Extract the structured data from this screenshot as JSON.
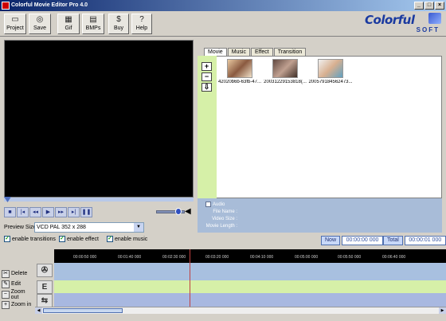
{
  "window": {
    "title": "Colorful Movie Editor Pro 4.0"
  },
  "toolbar": {
    "buttons": [
      {
        "label": "Project",
        "icon": "project-icon"
      },
      {
        "label": "Save",
        "icon": "save-icon"
      },
      {
        "label": "Gif",
        "icon": "gif-icon"
      },
      {
        "label": "BMPs",
        "icon": "bmps-icon"
      },
      {
        "label": "Buy",
        "icon": "dollar-icon"
      },
      {
        "label": "Help",
        "icon": "help-icon"
      }
    ]
  },
  "logo": {
    "line1": "Colorful",
    "line2": "SOFT"
  },
  "preview": {
    "size_label": "Preview Size",
    "size_value": "VCD PAL 352 x 288",
    "volume_level": 0.65
  },
  "options": {
    "enable_transitions": "enable transitions",
    "enable_effect": "enable effect",
    "enable_music": "enable music"
  },
  "media": {
    "tabs": [
      "Movie",
      "Music",
      "Effect",
      "Transition"
    ],
    "active_tab": "Movie",
    "items": [
      {
        "caption": "42020b6b-63fb-47..."
      },
      {
        "caption": "20031229153818(..."
      },
      {
        "caption": "200579184562473..."
      }
    ],
    "info": {
      "audio_label": "Audio",
      "file_name_label": "File Name :",
      "video_size_label": "Video Size :",
      "movie_length_label": "Movie Length :"
    }
  },
  "time": {
    "now_label": "Now",
    "now_value": "00:00:00 000",
    "total_label": "Total",
    "total_value": "00:00:01 000"
  },
  "timeline": {
    "actions": [
      "Delete",
      "Edit",
      "Zoom out",
      "Zoom in"
    ],
    "ruler_ticks": [
      "00:00:50 000",
      "00:01:40 000",
      "00:02:30 000",
      "00:03:20 000",
      "00:04:10 000",
      "00:05:00 000",
      "00:05:50 000",
      "00:06:40 000"
    ]
  },
  "colors": {
    "title_bar": "#0a246a",
    "media_sidebar": "#d6f0a8",
    "info_panel": "#a8bcd8",
    "video_track": "#a8c0e0",
    "effect_track": "#d6f0a8",
    "transition_track": "#a8b8e0"
  }
}
